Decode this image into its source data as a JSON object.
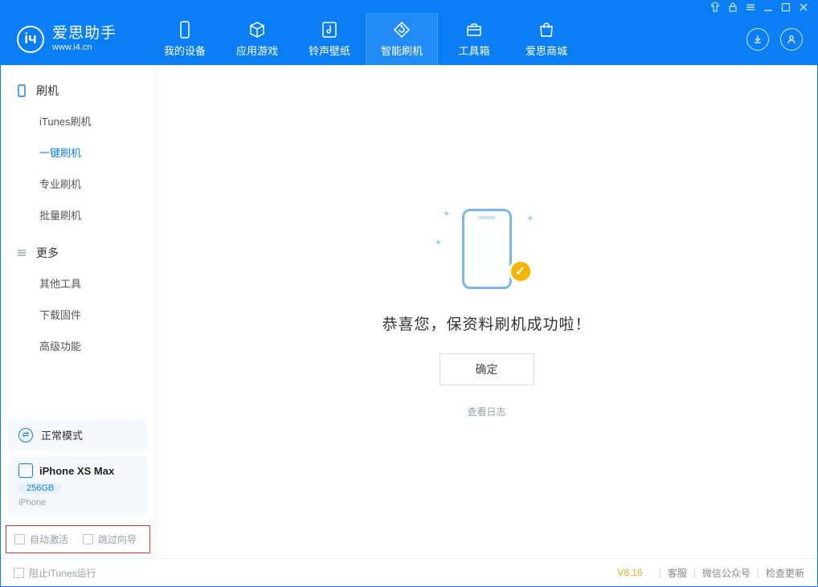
{
  "app": {
    "name": "爱思助手",
    "url": "www.i4.cn"
  },
  "nav": {
    "items": [
      {
        "label": "我的设备",
        "icon": "device-icon"
      },
      {
        "label": "应用游戏",
        "icon": "cube-icon"
      },
      {
        "label": "铃声壁纸",
        "icon": "music-icon"
      },
      {
        "label": "智能刷机",
        "icon": "refresh-icon",
        "active": true
      },
      {
        "label": "工具箱",
        "icon": "toolbox-icon"
      },
      {
        "label": "爱思商城",
        "icon": "bag-icon"
      }
    ]
  },
  "sidebar": {
    "cat1": "刷机",
    "items1": [
      {
        "label": "iTunes刷机"
      },
      {
        "label": "一键刷机",
        "active": true
      },
      {
        "label": "专业刷机"
      },
      {
        "label": "批量刷机"
      }
    ],
    "cat2": "更多",
    "items2": [
      {
        "label": "其他工具"
      },
      {
        "label": "下载固件"
      },
      {
        "label": "高级功能"
      }
    ],
    "mode": "正常模式",
    "device": {
      "name": "iPhone XS Max",
      "capacity": "256GB",
      "type": "iPhone"
    },
    "options": {
      "autoActivate": "自动激活",
      "skipGuide": "跳过向导"
    }
  },
  "main": {
    "message": "恭喜您，保资料刷机成功啦！",
    "ok": "确定",
    "viewLog": "查看日志"
  },
  "status": {
    "blockItunes": "阻止iTunes运行",
    "version": "V8.16",
    "links": [
      "客服",
      "微信公众号",
      "检查更新"
    ]
  }
}
